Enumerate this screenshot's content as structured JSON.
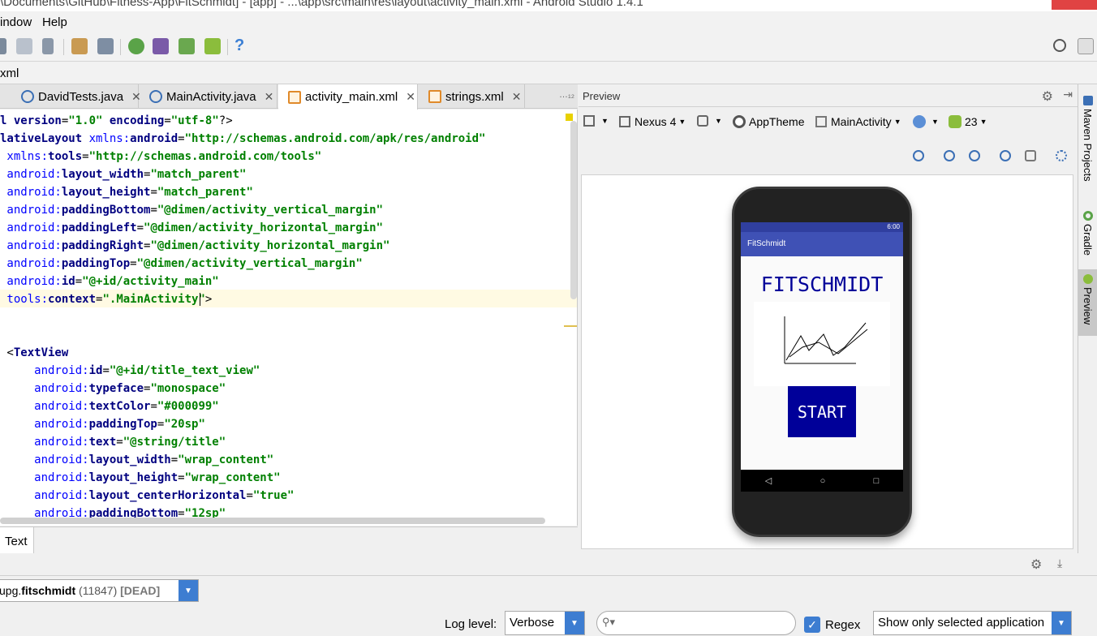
{
  "window": {
    "title": "\\Documents\\GitHub\\Fitness-App\\FitSchmidt] - [app] - ...\\app\\src\\main\\res\\layout\\activity_main.xml - Android Studio 1.4.1"
  },
  "menu": [
    "indow",
    "Help"
  ],
  "navbar": {
    "crumb": "xml"
  },
  "tabs": [
    {
      "label": "DavidTests.java",
      "icon": "java-class-icon",
      "active": false
    },
    {
      "label": "MainActivity.java",
      "icon": "java-class-icon",
      "active": false
    },
    {
      "label": "activity_main.xml",
      "icon": "xml-file-icon",
      "active": true
    },
    {
      "label": "strings.xml",
      "icon": "xml-file-icon",
      "active": false
    }
  ],
  "tabs_more": "…₁₂",
  "editor": {
    "lines": [
      [
        [
          "t",
          "l version"
        ],
        [
          "p",
          "="
        ],
        [
          "v",
          "\"1.0\""
        ],
        [
          "t",
          " encoding"
        ],
        [
          "p",
          "="
        ],
        [
          "v",
          "\"utf-8\""
        ],
        [
          "p",
          "?>"
        ]
      ],
      [
        [
          "t",
          "lativeLayout "
        ],
        [
          "a",
          "xmlns:"
        ],
        [
          "t",
          "android"
        ],
        [
          "p",
          "="
        ],
        [
          "v",
          "\"http://schemas.android.com/apk/res/android\""
        ]
      ],
      [
        [
          "a",
          " xmlns:"
        ],
        [
          "t",
          "tools"
        ],
        [
          "p",
          "="
        ],
        [
          "v",
          "\"http://schemas.android.com/tools\""
        ]
      ],
      [
        [
          "a",
          " android:"
        ],
        [
          "t",
          "layout_width"
        ],
        [
          "p",
          "="
        ],
        [
          "v",
          "\"match_parent\""
        ]
      ],
      [
        [
          "a",
          " android:"
        ],
        [
          "t",
          "layout_height"
        ],
        [
          "p",
          "="
        ],
        [
          "v",
          "\"match_parent\""
        ]
      ],
      [
        [
          "a",
          " android:"
        ],
        [
          "t",
          "paddingBottom"
        ],
        [
          "p",
          "="
        ],
        [
          "v",
          "\"@dimen/activity_vertical_margin\""
        ]
      ],
      [
        [
          "a",
          " android:"
        ],
        [
          "t",
          "paddingLeft"
        ],
        [
          "p",
          "="
        ],
        [
          "v",
          "\"@dimen/activity_horizontal_margin\""
        ]
      ],
      [
        [
          "a",
          " android:"
        ],
        [
          "t",
          "paddingRight"
        ],
        [
          "p",
          "="
        ],
        [
          "v",
          "\"@dimen/activity_horizontal_margin\""
        ]
      ],
      [
        [
          "a",
          " android:"
        ],
        [
          "t",
          "paddingTop"
        ],
        [
          "p",
          "="
        ],
        [
          "v",
          "\"@dimen/activity_vertical_margin\""
        ]
      ],
      [
        [
          "a",
          " android:"
        ],
        [
          "t",
          "id"
        ],
        [
          "p",
          "="
        ],
        [
          "v",
          "\"@+id/activity_main\""
        ]
      ],
      [
        [
          "a",
          " tools:"
        ],
        [
          "t",
          "context"
        ],
        [
          "p",
          "="
        ],
        [
          "v",
          "\".MainActivity\""
        ],
        [
          "p",
          ">"
        ]
      ],
      [],
      [],
      [
        [
          "p",
          " <"
        ],
        [
          "t",
          "TextView"
        ]
      ],
      [
        [
          "a",
          "     android:"
        ],
        [
          "t",
          "id"
        ],
        [
          "p",
          "="
        ],
        [
          "v",
          "\"@+id/title_text_view\""
        ]
      ],
      [
        [
          "a",
          "     android:"
        ],
        [
          "t",
          "typeface"
        ],
        [
          "p",
          "="
        ],
        [
          "v",
          "\"monospace\""
        ]
      ],
      [
        [
          "a",
          "     android:"
        ],
        [
          "t",
          "textColor"
        ],
        [
          "p",
          "="
        ],
        [
          "v",
          "\"#000099\""
        ]
      ],
      [
        [
          "a",
          "     android:"
        ],
        [
          "t",
          "paddingTop"
        ],
        [
          "p",
          "="
        ],
        [
          "v",
          "\"20sp\""
        ]
      ],
      [
        [
          "a",
          "     android:"
        ],
        [
          "t",
          "text"
        ],
        [
          "p",
          "="
        ],
        [
          "v",
          "\"@string/title\""
        ]
      ],
      [
        [
          "a",
          "     android:"
        ],
        [
          "t",
          "layout_width"
        ],
        [
          "p",
          "="
        ],
        [
          "v",
          "\"wrap_content\""
        ]
      ],
      [
        [
          "a",
          "     android:"
        ],
        [
          "t",
          "layout_height"
        ],
        [
          "p",
          "="
        ],
        [
          "v",
          "\"wrap_content\""
        ]
      ],
      [
        [
          "a",
          "     android:"
        ],
        [
          "t",
          "layout_centerHorizontal"
        ],
        [
          "p",
          "="
        ],
        [
          "v",
          "\"true\""
        ]
      ],
      [
        [
          "a",
          "     android:"
        ],
        [
          "t",
          "paddingBottom"
        ],
        [
          "p",
          "="
        ],
        [
          "v",
          "\"12sp\""
        ]
      ]
    ],
    "bottom_tab": "Text"
  },
  "preview": {
    "label": "Preview",
    "device": "Nexus 4",
    "theme": "AppTheme",
    "activity": "MainActivity",
    "api": "23",
    "phone": {
      "status_time": "6:00",
      "app_name": "FitSchmidt",
      "title": "FITSCHMIDT",
      "button": "START",
      "nav": [
        "◁",
        "○",
        "□"
      ]
    }
  },
  "right_tabs": [
    "Maven Projects",
    "Gradle",
    "Preview"
  ],
  "logcat": {
    "process_prefix": "upg.",
    "process_name": "fitschmidt",
    "process_pid": "(11847)",
    "process_state": "[DEAD]",
    "log_level_label": "Log level:",
    "log_level": "Verbose",
    "search_placeholder": "",
    "regex_label": "Regex",
    "filter": "Show only selected application"
  },
  "colors": {
    "accent": "#3d7dd1",
    "app_primary": "#3f51b5",
    "title_text": "#000099"
  }
}
